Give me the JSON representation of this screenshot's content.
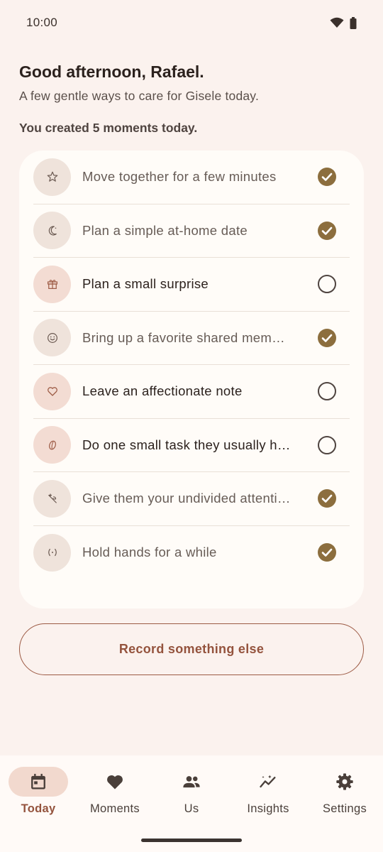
{
  "status_bar": {
    "time": "10:00"
  },
  "header": {
    "greeting": "Good afternoon, Rafael.",
    "subtitle": "A few gentle ways to care for Gisele today.",
    "summary": "You created 5 moments today."
  },
  "moments": [
    {
      "label": "Move together for a few minutes",
      "icon": "star-icon",
      "done": true
    },
    {
      "label": "Plan a simple at-home date",
      "icon": "moon-icon",
      "done": true
    },
    {
      "label": "Plan a small surprise",
      "icon": "gift-icon",
      "done": false
    },
    {
      "label": "Bring up a favorite shared mem…",
      "icon": "smile-icon",
      "done": true
    },
    {
      "label": "Leave an affectionate note",
      "icon": "heart-icon",
      "done": false
    },
    {
      "label": "Do one small task they usually h…",
      "icon": "bean-icon",
      "done": false
    },
    {
      "label": "Give them your undivided attenti…",
      "icon": "sparkle-icon",
      "done": true
    },
    {
      "label": "Hold hands for a while",
      "icon": "connect-icon",
      "done": true
    }
  ],
  "record_button": "Record something else",
  "nav": [
    {
      "label": "Today",
      "icon": "calendar-icon",
      "active": true
    },
    {
      "label": "Moments",
      "icon": "heart-icon",
      "active": false
    },
    {
      "label": "Us",
      "icon": "people-icon",
      "active": false
    },
    {
      "label": "Insights",
      "icon": "insights-icon",
      "active": false
    },
    {
      "label": "Settings",
      "icon": "gear-icon",
      "active": false
    }
  ],
  "colors": {
    "background": "#fbf2ee",
    "card": "#fffcf8",
    "accent": "#94533d",
    "check": "#8c6e3e"
  }
}
